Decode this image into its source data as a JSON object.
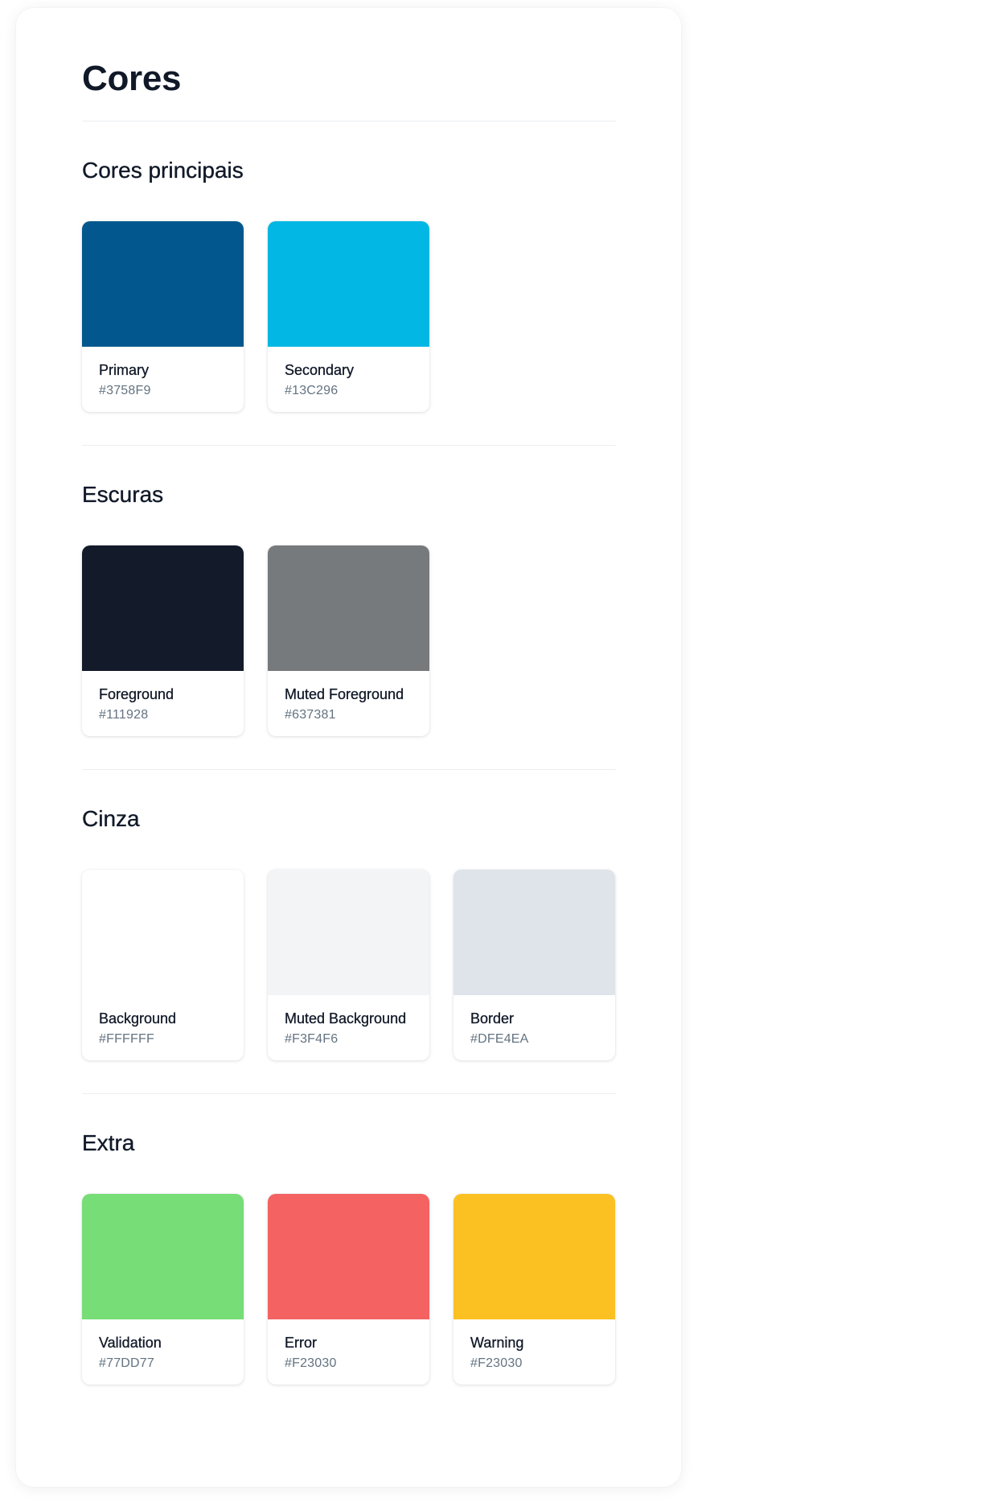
{
  "page": {
    "title": "Cores"
  },
  "sections": [
    {
      "title": "Cores principais",
      "swatches": [
        {
          "name": "Primary",
          "hex": "#3758F9",
          "display_color": "#02588E"
        },
        {
          "name": "Secondary",
          "hex": "#13C296",
          "display_color": "#02B7E3"
        }
      ]
    },
    {
      "title": "Escuras",
      "swatches": [
        {
          "name": "Foreground",
          "hex": "#111928",
          "display_color": "#131A29"
        },
        {
          "name": "Muted Foreground",
          "hex": "#637381",
          "display_color": "#777A7C"
        }
      ]
    },
    {
      "title": "Cinza",
      "swatches": [
        {
          "name": "Background",
          "hex": "#FFFFFF",
          "display_color": "#FFFFFF"
        },
        {
          "name": "Muted Background",
          "hex": "#F3F4F6",
          "display_color": "#F3F4F6"
        },
        {
          "name": "Border",
          "hex": "#DFE4EA",
          "display_color": "#DFE4EA"
        }
      ]
    },
    {
      "title": "Extra",
      "swatches": [
        {
          "name": "Validation",
          "hex": "#77DD77",
          "display_color": "#77DD77"
        },
        {
          "name": "Error",
          "hex": "#F23030",
          "display_color": "#F46262"
        },
        {
          "name": "Warning",
          "hex": "#F23030",
          "display_color": "#FBC022"
        }
      ]
    }
  ]
}
